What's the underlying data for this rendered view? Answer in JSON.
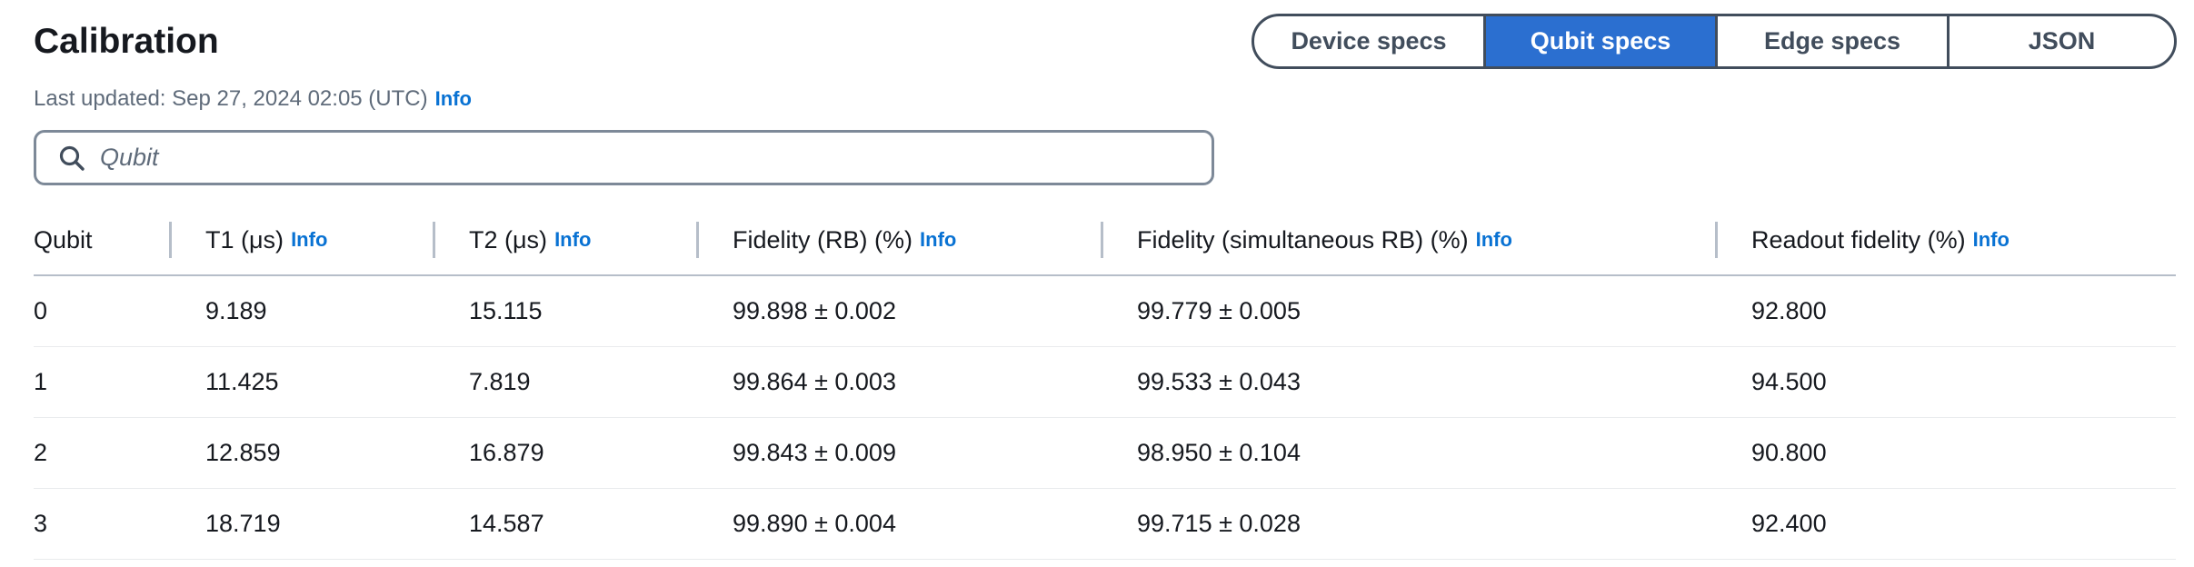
{
  "header": {
    "title": "Calibration",
    "last_updated": "Last updated: Sep 27, 2024 02:05 (UTC)",
    "info_label": "Info"
  },
  "segments": [
    {
      "label": "Device specs",
      "active": false
    },
    {
      "label": "Qubit specs",
      "active": true
    },
    {
      "label": "Edge specs",
      "active": false
    },
    {
      "label": "JSON",
      "active": false
    }
  ],
  "search": {
    "placeholder": "Qubit",
    "value": ""
  },
  "table": {
    "columns": [
      {
        "label": "Qubit",
        "info": ""
      },
      {
        "label": "T1 (μs)",
        "info": "Info"
      },
      {
        "label": "T2 (μs)",
        "info": "Info"
      },
      {
        "label": "Fidelity (RB) (%)",
        "info": "Info"
      },
      {
        "label": "Fidelity (simultaneous RB) (%)",
        "info": "Info"
      },
      {
        "label": "Readout fidelity (%)",
        "info": "Info"
      }
    ],
    "rows": [
      [
        "0",
        "9.189",
        "15.115",
        "99.898 ± 0.002",
        "99.779 ± 0.005",
        "92.800"
      ],
      [
        "1",
        "11.425",
        "7.819",
        "99.864 ± 0.003",
        "99.533 ± 0.043",
        "94.500"
      ],
      [
        "2",
        "12.859",
        "16.879",
        "99.843 ± 0.009",
        "98.950 ± 0.104",
        "90.800"
      ],
      [
        "3",
        "18.719",
        "14.587",
        "99.890 ± 0.004",
        "99.715 ± 0.028",
        "92.400"
      ]
    ]
  },
  "colors": {
    "accent": "#2b6fd0",
    "link": "#0972d3",
    "text": "#16191f",
    "muted": "#5f6b7a"
  }
}
